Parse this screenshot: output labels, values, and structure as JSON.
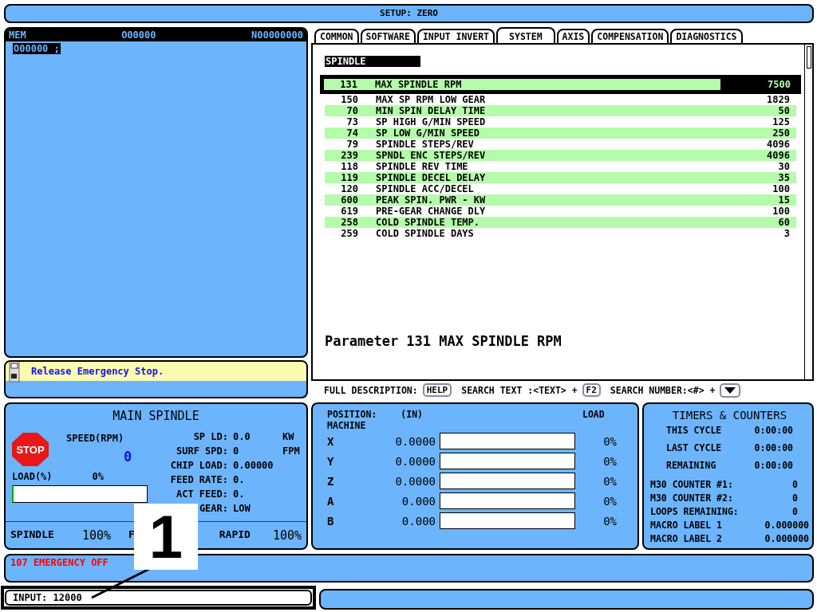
{
  "header": {
    "title": "SETUP:  ZERO"
  },
  "program": {
    "mode": "MEM",
    "program_number": "O00000",
    "sequence": "N00000000",
    "lines": [
      "O00000 ;"
    ]
  },
  "message": {
    "text": "Release Emergency Stop."
  },
  "tabs": [
    {
      "label": "COMMON",
      "selected": false
    },
    {
      "label": "SOFTWARE",
      "selected": false
    },
    {
      "label": "INPUT INVERT",
      "selected": false
    },
    {
      "label": "SYSTEM",
      "selected": true
    },
    {
      "label": "AXIS",
      "selected": false
    },
    {
      "label": "COMPENSATION",
      "selected": false
    },
    {
      "label": "DIAGNOSTICS",
      "selected": false
    }
  ],
  "parameters": {
    "group": "SPINDLE",
    "rows": [
      {
        "number": "131",
        "name": "MAX SPINDLE RPM",
        "value": "7500",
        "selected": true
      },
      {
        "number": "150",
        "name": "MAX SP RPM LOW GEAR",
        "value": "1829",
        "selected": false
      },
      {
        "number": "70",
        "name": "MIN SPIN DELAY TIME",
        "value": "50",
        "selected": false
      },
      {
        "number": "73",
        "name": "SP HIGH G/MIN SPEED",
        "value": "125",
        "selected": false
      },
      {
        "number": "74",
        "name": "SP LOW G/MIN SPEED",
        "value": "250",
        "selected": false
      },
      {
        "number": "79",
        "name": "SPINDLE STEPS/REV",
        "value": "4096",
        "selected": false
      },
      {
        "number": "239",
        "name": "SPNDL ENC STEPS/REV",
        "value": "4096",
        "selected": false
      },
      {
        "number": "118",
        "name": "SPINDLE REV TIME",
        "value": "30",
        "selected": false
      },
      {
        "number": "119",
        "name": "SPINDLE DECEL DELAY",
        "value": "35",
        "selected": false
      },
      {
        "number": "120",
        "name": "SPINDLE ACC/DECEL",
        "value": "100",
        "selected": false
      },
      {
        "number": "600",
        "name": "PEAK SPIN. PWR - KW",
        "value": "15",
        "selected": false
      },
      {
        "number": "619",
        "name": "PRE-GEAR CHANGE DLY",
        "value": "100",
        "selected": false
      },
      {
        "number": "258",
        "name": "COLD SPINDLE TEMP.",
        "value": "60",
        "selected": false
      },
      {
        "number": "259",
        "name": "COLD SPINDLE DAYS",
        "value": "3",
        "selected": false
      }
    ],
    "description": "Parameter 131 MAX SPINDLE RPM"
  },
  "help_bar": [
    {
      "kind": "key",
      "label": "FULL DESCRIPTION:",
      "key": "HELP"
    },
    {
      "kind": "key",
      "label": "SEARCH TEXT :<TEXT> +",
      "key": "F2"
    },
    {
      "kind": "arrow",
      "label": "SEARCH NUMBER:<#> +"
    }
  ],
  "spindle": {
    "title": "MAIN SPINDLE",
    "stop": "STOP",
    "speed_label": "SPEED(RPM)",
    "speed": "0",
    "load_label": "LOAD(%)",
    "load_value": "0%",
    "level": 0,
    "stats": [
      {
        "label": "SP LD:",
        "value": "0.0",
        "unit": "KW"
      },
      {
        "label": "SURF SPD:",
        "value": "0",
        "unit": "FPM"
      },
      {
        "label": "CHIP LOAD:",
        "value": "0.00000"
      },
      {
        "label": "FEED RATE:",
        "value": "0."
      },
      {
        "label": "ACT FEED:",
        "value": "0."
      },
      {
        "label": "GEAR:",
        "value": "LOW"
      }
    ],
    "overrides": [
      {
        "label": "SPINDLE",
        "value": "100%"
      },
      {
        "label": "F"
      },
      {
        "label": "RAPID",
        "value": "100%"
      }
    ]
  },
  "position": {
    "title": "POSITION:",
    "units": "(IN)",
    "mode": "MACHINE",
    "load_label": "LOAD",
    "axes": [
      {
        "axis": "X",
        "value": "0.0000",
        "load": "0%",
        "level": 0
      },
      {
        "axis": "Y",
        "value": "0.0000",
        "load": "0%",
        "level": 0
      },
      {
        "axis": "Z",
        "value": "0.0000",
        "load": "0%",
        "level": 0
      },
      {
        "axis": "A",
        "value": "0.000",
        "load": "0%",
        "level": 0
      },
      {
        "axis": "B",
        "value": "0.000",
        "load": "0%",
        "level": 0
      }
    ]
  },
  "timers": {
    "title": "TIMERS & COUNTERS",
    "timers": [
      {
        "label": "THIS CYCLE",
        "value": "0:00:00"
      },
      {
        "label": "LAST CYCLE",
        "value": "0:00:00"
      },
      {
        "label": "REMAINING",
        "value": "0:00:00"
      }
    ],
    "counters": [
      {
        "label": "M30 COUNTER #1:",
        "value": "0"
      },
      {
        "label": "M30 COUNTER #2:",
        "value": "0"
      },
      {
        "label": "LOOPS REMAINING:",
        "value": "0"
      },
      {
        "label": "MACRO LABEL 1",
        "value": "0.000000"
      },
      {
        "label": "MACRO LABEL 2",
        "value": "0.000000"
      }
    ]
  },
  "alarm": {
    "text": "107 EMERGENCY OFF"
  },
  "input": {
    "text": "INPUT: 12000"
  },
  "callout": {
    "label": "1"
  }
}
